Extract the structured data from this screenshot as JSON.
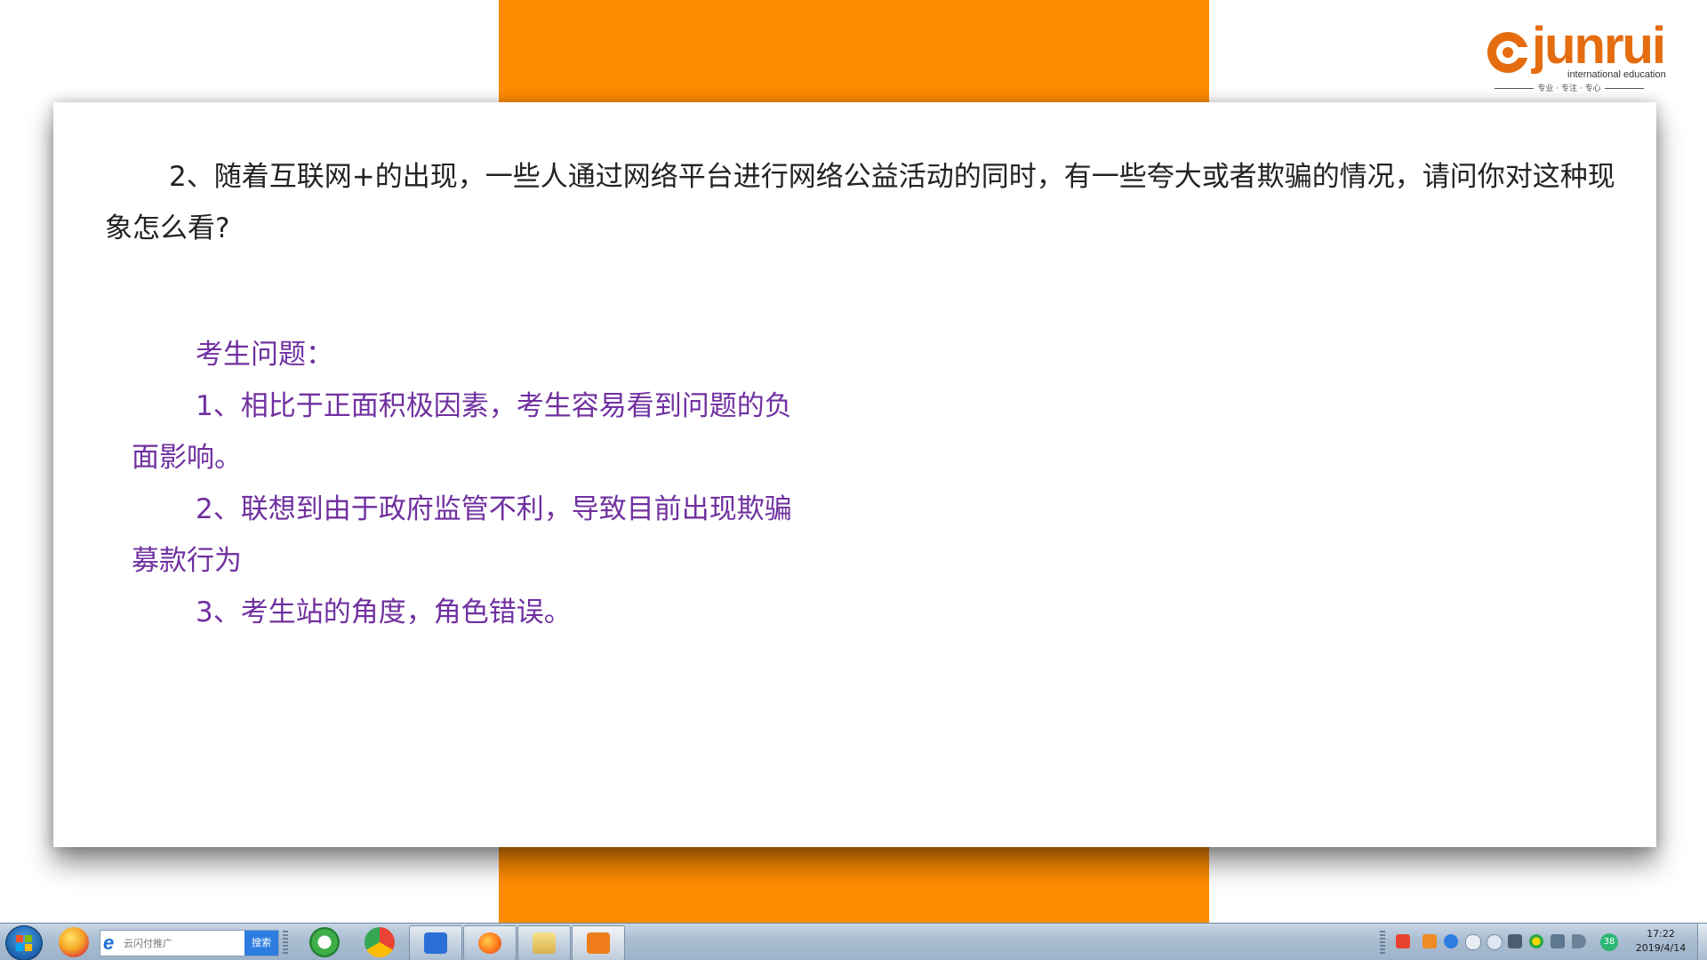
{
  "slide": {
    "question_text": "2、随着互联网+的出现，一些人通过网络平台进行网络公益活动的同时，有一些夸大或者欺骗的情况，请问你对这种现象怎么看?",
    "analysis": {
      "heading": "考生问题：",
      "items": [
        {
          "first": "1、相比于正面积极因素，考生容易看到问题的负",
          "rest": "面影响。"
        },
        {
          "first": "2、联想到由于政府监管不利，导致目前出现欺骗",
          "rest": "募款行为"
        },
        {
          "first": "3、考生站的角度，角色错误。",
          "rest": ""
        }
      ]
    },
    "logo": {
      "wordmark": "junrui",
      "subtitle": "international education",
      "tagline": "专业 · 专注 · 专心"
    },
    "colors": {
      "band": "#ff8c00",
      "logo": "#e56d10",
      "analysis_text": "#7030a0",
      "question_text": "#222222"
    }
  },
  "taskbar": {
    "search_placeholder": "云闪付推广",
    "search_button": "搜索",
    "pinned": [
      "windows-orb-icon",
      "qq-icon",
      "ie-browser-icon",
      "chrome-icon",
      "wps-writer-icon",
      "firefox-icon",
      "file-explorer-icon",
      "media-player-icon"
    ],
    "tray_badge": "38",
    "clock_time": "17:22",
    "clock_date": "2019/4/14"
  }
}
